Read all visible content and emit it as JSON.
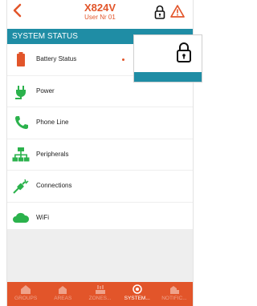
{
  "header": {
    "title": "X824V",
    "subtitle": "User Nr 01",
    "back_icon": "back-chevron-icon",
    "lock_icon": "lock-icon",
    "warning_icon": "warning-icon"
  },
  "section_title": "SYSTEM STATUS",
  "status_items": [
    {
      "label": "Battery Status",
      "icon": "battery-icon"
    },
    {
      "label": "Power",
      "icon": "power-plug-icon"
    },
    {
      "label": "Phone Line",
      "icon": "phone-icon"
    },
    {
      "label": "Peripherals",
      "icon": "peripherals-icon"
    },
    {
      "label": "Connections",
      "icon": "connections-icon"
    },
    {
      "label": "WiFi",
      "icon": "wifi-cloud-icon"
    }
  ],
  "tabs": [
    {
      "label": "GROUPS",
      "icon": "groups-icon",
      "active": false
    },
    {
      "label": "AREAS",
      "icon": "areas-icon",
      "active": false
    },
    {
      "label": "ZONES...",
      "icon": "zones-icon",
      "active": false
    },
    {
      "label": "SYSTEM...",
      "icon": "system-icon",
      "active": true
    },
    {
      "label": "NOTIFIC...",
      "icon": "notifications-icon",
      "active": false
    }
  ],
  "colors": {
    "accent": "#e2552a",
    "teal": "#1f8da5",
    "green": "#2bb24c"
  }
}
